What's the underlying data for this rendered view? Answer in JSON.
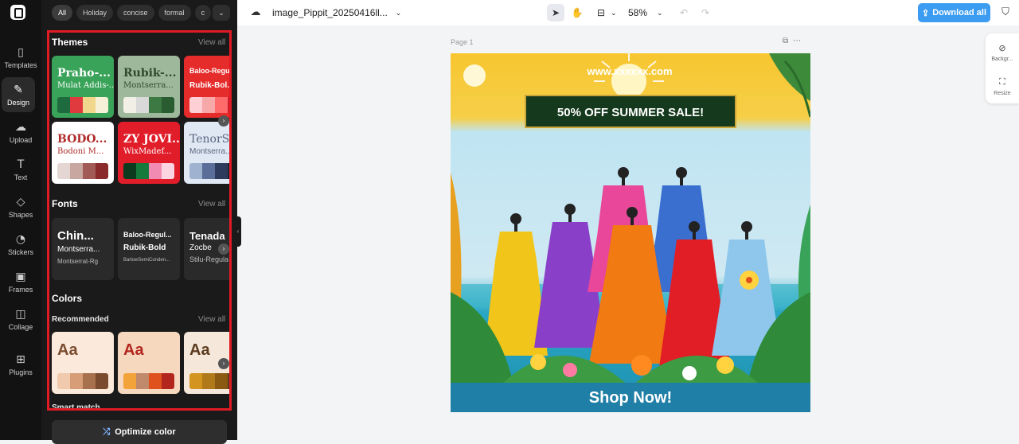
{
  "rail": {
    "items": [
      {
        "label": "Templates",
        "icon": "▯"
      },
      {
        "label": "Design",
        "icon": "✎"
      },
      {
        "label": "Upload",
        "icon": "☁"
      },
      {
        "label": "Text",
        "icon": "T"
      },
      {
        "label": "Shapes",
        "icon": "◇"
      },
      {
        "label": "Stickers",
        "icon": "◔"
      },
      {
        "label": "Frames",
        "icon": "▣"
      },
      {
        "label": "Collage",
        "icon": "◫"
      },
      {
        "label": "Plugins",
        "icon": "⊞"
      }
    ]
  },
  "filters": {
    "chips": [
      "All",
      "Holiday",
      "concise",
      "formal",
      "c"
    ],
    "more": "⌄"
  },
  "themes": {
    "title": "Themes",
    "view_all": "View all",
    "cards": [
      {
        "title": "Praho-...",
        "sub": "Mulat Addis-...",
        "bg": "#3aa35a",
        "fg": "#ffffff",
        "swatches": [
          "#1d6b3e",
          "#e0393e",
          "#f0d78c",
          "#f7f0d8"
        ]
      },
      {
        "title": "Rubik-...",
        "sub": "Montserra...",
        "bg": "#9db89a",
        "fg": "#2f4a2f",
        "swatches": [
          "#f2efe6",
          "#d9d9d9",
          "#3d7a43",
          "#2a5c31"
        ]
      },
      {
        "title": "Baloo-Regu...",
        "sub": "Rubik-Bol...",
        "bg": "#e62b2b",
        "fg": "#ffffff",
        "swatches": [
          "#ffcfd6",
          "#f7a8a8",
          "#ff6b6b",
          "#d01e2e"
        ]
      },
      {
        "title": "BODO...",
        "sub": "Bodoni M...",
        "bg": "#ffffff",
        "fg": "#b02a2a",
        "swatches": [
          "#e4d6d2",
          "#c9a7a1",
          "#a25a56",
          "#8b2a2a"
        ]
      },
      {
        "title": "ZY JOVI...",
        "sub": "WixMadef...",
        "bg": "#e11d2a",
        "fg": "#ffffff",
        "swatches": [
          "#0b3a1e",
          "#157a3c",
          "#f28bb1",
          "#fcd5e2"
        ]
      },
      {
        "title": "TenorS...",
        "sub": "Montserra...",
        "bg": "#dfe8f3",
        "fg": "#5a6680",
        "swatches": [
          "#9fb3d1",
          "#5b6e99",
          "#2f3b5c",
          "#1e2438"
        ]
      }
    ]
  },
  "fonts": {
    "title": "Fonts",
    "view_all": "View all",
    "cards": [
      {
        "title": "Chin...",
        "sub": "Montserra...",
        "sub2": "Montserrat-Rg"
      },
      {
        "title": "Baloo-Regul...",
        "sub": "Rubik-Bold",
        "sub2": "BarlowSemiConden..."
      },
      {
        "title": "Tenada",
        "sub": "Zocbe",
        "sub2": "Stilu-Regula"
      }
    ]
  },
  "colors": {
    "title": "Colors",
    "recommended": "Recommended",
    "view_all": "View all",
    "smart_match": "Smart match",
    "cards": [
      {
        "aa": "Aa",
        "bg": "#fbe9dc",
        "fg": "#7a4b2e",
        "swatches": [
          "#f1c9ad",
          "#d79d77",
          "#a8714e",
          "#7a4b2e"
        ]
      },
      {
        "aa": "Aa",
        "bg": "#f6d8be",
        "fg": "#b3261e",
        "swatches": [
          "#f2a33a",
          "#c0896b",
          "#e0521d",
          "#b3261e"
        ]
      },
      {
        "aa": "Aa",
        "bg": "#f5e8da",
        "fg": "#5c3a1e",
        "swatches": [
          "#d49520",
          "#b07a1a",
          "#8a5a12",
          "#5c3a1e"
        ]
      }
    ]
  },
  "optimize": {
    "label": "Optimize color",
    "icon": "⤮"
  },
  "toolbar": {
    "cloud_icon": "☁",
    "filename": "image_Pippit_20250416ll...",
    "select_icon": "➤",
    "hand_icon": "✋",
    "layout_icon": "⊟",
    "zoom": "58%",
    "undo_icon": "↶",
    "redo_icon": "↷",
    "download_label": "Download all",
    "download_icon": "⇪",
    "shield_icon": "⛉"
  },
  "canvas": {
    "page_label": "Page 1",
    "tools": "⧉⋯",
    "artwork": {
      "url": "www.xxxxxx.com",
      "headline": "50% OFF SUMMER SALE!",
      "cta": "Shop Now!"
    }
  },
  "float_panel": {
    "items": [
      {
        "label": "Backgr...",
        "icon": "⊘"
      },
      {
        "label": "Resize",
        "icon": "⛶"
      }
    ]
  },
  "colors_theme": {
    "accent": "#3b9cf1",
    "highlight": "#e01b24",
    "panel_bg": "#1a1a1a"
  }
}
